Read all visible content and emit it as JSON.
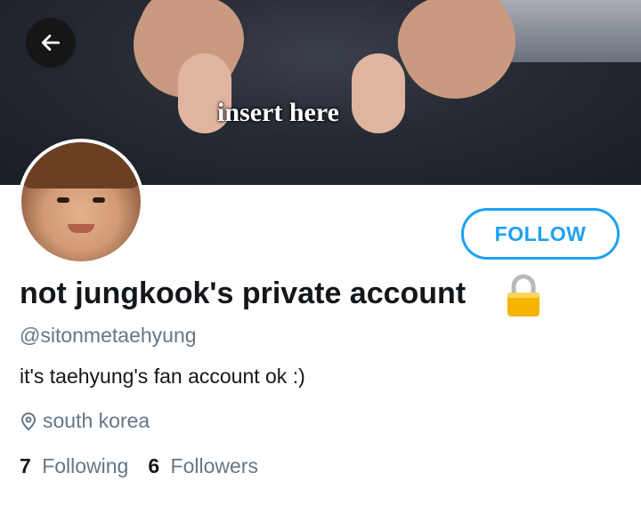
{
  "banner": {
    "caption": "insert here"
  },
  "header": {
    "back_icon": "arrow-left-icon"
  },
  "profile": {
    "display_name": "not jungkook's private account",
    "lock_icon": "lock-icon",
    "handle": "@sitonmetaehyung",
    "bio": "it's taehyung's fan account ok :)",
    "location_icon": "location-pin-icon",
    "location": "south korea",
    "following_count": "7",
    "following_label": "Following",
    "followers_count": "6",
    "followers_label": "Followers"
  },
  "actions": {
    "follow_label": "FOLLOW"
  },
  "colors": {
    "accent": "#1da1f2",
    "secondary_text": "#657786",
    "primary_text": "#14171a"
  }
}
